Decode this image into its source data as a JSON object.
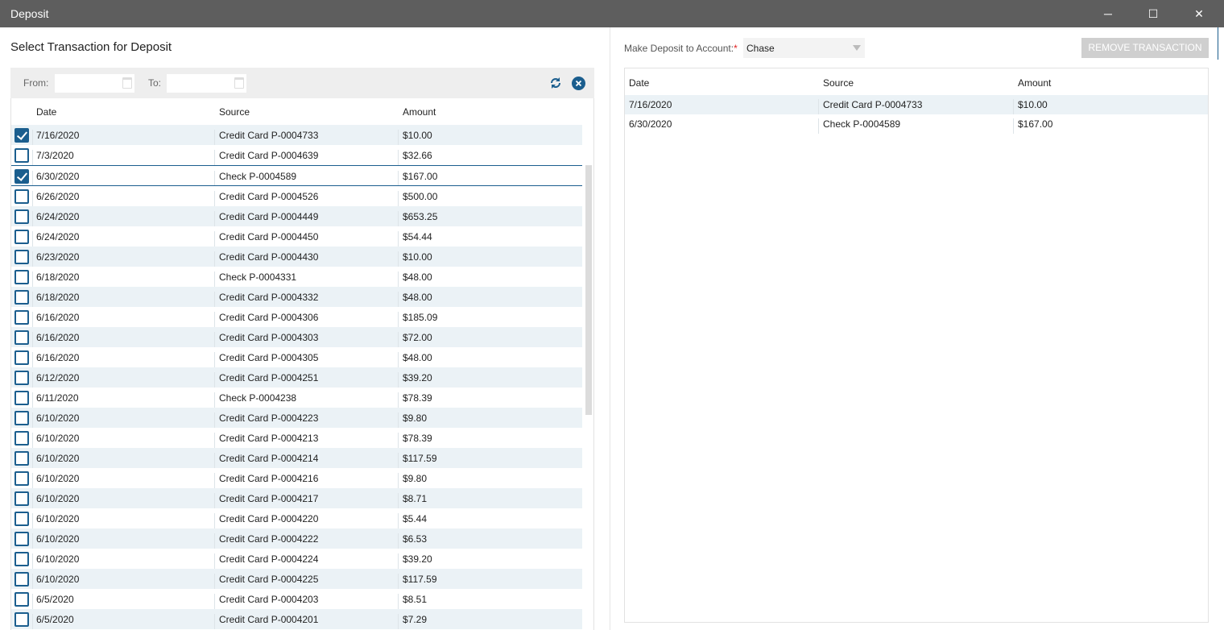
{
  "window": {
    "title": "Deposit",
    "minimize": "─",
    "maximize": "☐",
    "close": "✕"
  },
  "left": {
    "title": "Select Transaction for Deposit",
    "filter": {
      "from_label": "From:",
      "from_value": "",
      "to_label": "To:",
      "to_value": ""
    },
    "columns": [
      "Date",
      "Source",
      "Amount"
    ],
    "rows": [
      {
        "checked": true,
        "date": "7/16/2020",
        "source": "Credit Card P-0004733",
        "amount": "$10.00"
      },
      {
        "checked": false,
        "date": "7/3/2020",
        "source": "Credit Card P-0004639",
        "amount": "$32.66"
      },
      {
        "checked": true,
        "date": "6/30/2020",
        "source": "Check P-0004589",
        "amount": "$167.00"
      },
      {
        "checked": false,
        "date": "6/26/2020",
        "source": "Credit Card P-0004526",
        "amount": "$500.00"
      },
      {
        "checked": false,
        "date": "6/24/2020",
        "source": "Credit Card P-0004449",
        "amount": "$653.25"
      },
      {
        "checked": false,
        "date": "6/24/2020",
        "source": "Credit Card P-0004450",
        "amount": "$54.44"
      },
      {
        "checked": false,
        "date": "6/23/2020",
        "source": "Credit Card P-0004430",
        "amount": "$10.00"
      },
      {
        "checked": false,
        "date": "6/18/2020",
        "source": "Check P-0004331",
        "amount": "$48.00"
      },
      {
        "checked": false,
        "date": "6/18/2020",
        "source": "Credit Card P-0004332",
        "amount": "$48.00"
      },
      {
        "checked": false,
        "date": "6/16/2020",
        "source": "Credit Card P-0004306",
        "amount": "$185.09"
      },
      {
        "checked": false,
        "date": "6/16/2020",
        "source": "Credit Card P-0004303",
        "amount": "$72.00"
      },
      {
        "checked": false,
        "date": "6/16/2020",
        "source": "Credit Card P-0004305",
        "amount": "$48.00"
      },
      {
        "checked": false,
        "date": "6/12/2020",
        "source": "Credit Card P-0004251",
        "amount": "$39.20"
      },
      {
        "checked": false,
        "date": "6/11/2020",
        "source": "Check P-0004238",
        "amount": "$78.39"
      },
      {
        "checked": false,
        "date": "6/10/2020",
        "source": "Credit Card P-0004223",
        "amount": "$9.80"
      },
      {
        "checked": false,
        "date": "6/10/2020",
        "source": "Credit Card P-0004213",
        "amount": "$78.39"
      },
      {
        "checked": false,
        "date": "6/10/2020",
        "source": "Credit Card P-0004214",
        "amount": "$117.59"
      },
      {
        "checked": false,
        "date": "6/10/2020",
        "source": "Credit Card P-0004216",
        "amount": "$9.80"
      },
      {
        "checked": false,
        "date": "6/10/2020",
        "source": "Credit Card P-0004217",
        "amount": "$8.71"
      },
      {
        "checked": false,
        "date": "6/10/2020",
        "source": "Credit Card P-0004220",
        "amount": "$5.44"
      },
      {
        "checked": false,
        "date": "6/10/2020",
        "source": "Credit Card P-0004222",
        "amount": "$6.53"
      },
      {
        "checked": false,
        "date": "6/10/2020",
        "source": "Credit Card P-0004224",
        "amount": "$39.20"
      },
      {
        "checked": false,
        "date": "6/10/2020",
        "source": "Credit Card P-0004225",
        "amount": "$117.59"
      },
      {
        "checked": false,
        "date": "6/5/2020",
        "source": "Credit Card P-0004203",
        "amount": "$8.51"
      },
      {
        "checked": false,
        "date": "6/5/2020",
        "source": "Credit Card P-0004201",
        "amount": "$7.29"
      }
    ]
  },
  "right": {
    "account_label": "Make Deposit to Account:",
    "required_mark": "*",
    "account_value": "Chase",
    "remove_button": "REMOVE TRANSACTION",
    "columns": [
      "Date",
      "Source",
      "Amount"
    ],
    "rows": [
      {
        "date": "7/16/2020",
        "source": "Credit Card P-0004733",
        "amount": "$10.00"
      },
      {
        "date": "6/30/2020",
        "source": "Check P-0004589",
        "amount": "$167.00"
      }
    ]
  },
  "colors": {
    "accent": "#1b5e8e",
    "titlebar": "#5e5e5e",
    "row_alt": "#ebf2f6"
  }
}
